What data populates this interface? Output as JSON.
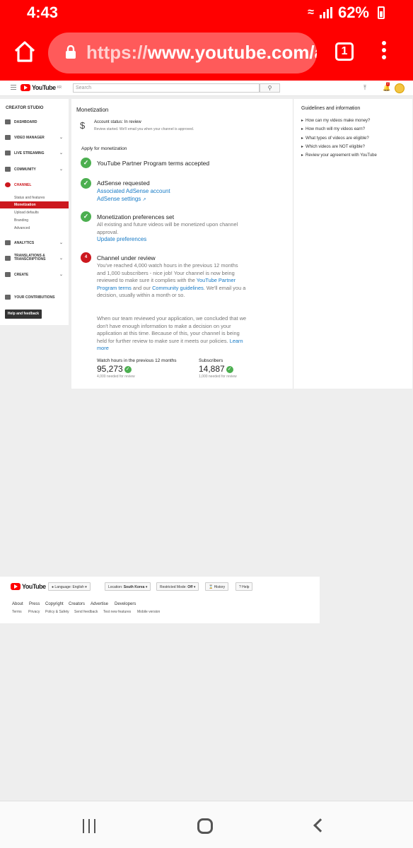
{
  "status_bar": {
    "time": "4:43",
    "battery": "62%"
  },
  "browser": {
    "url_scheme": "https://",
    "url_rest": "www.youtube.com/a",
    "tab_count": "1"
  },
  "header": {
    "logo_text": "YouTube",
    "logo_sup": "KR",
    "search_placeholder": "Search"
  },
  "notifications": {
    "count": "7"
  },
  "sidebar": {
    "title": "CREATOR STUDIO",
    "items": [
      {
        "label": "DASHBOARD"
      },
      {
        "label": "VIDEO MANAGER"
      },
      {
        "label": "LIVE STREAMING"
      },
      {
        "label": "COMMUNITY"
      },
      {
        "label": "CHANNEL"
      },
      {
        "label": "ANALYTICS"
      },
      {
        "label": "TRANSLATIONS & TRANSCRIPTIONS"
      },
      {
        "label": "CREATE"
      },
      {
        "label": "YOUR CONTRIBUTIONS"
      }
    ],
    "channel_sub": [
      "Status and features",
      "Monetization",
      "Upload defaults",
      "Branding",
      "Advanced"
    ],
    "help_button": "Help and feedback"
  },
  "main": {
    "title": "Monetization",
    "account_status": "Account status: In review",
    "account_sub": "Review started. We'll email you when your channel is approved.",
    "apply_title": "Apply for monetization",
    "steps": [
      {
        "title": "YouTube Partner Program terms accepted"
      },
      {
        "title": "AdSense requested",
        "link1": "Associated AdSense account",
        "link2": "AdSense settings"
      },
      {
        "title": "Monetization preferences set",
        "text": "All existing and future videos will be monetized upon channel approval.",
        "link": "Update preferences"
      },
      {
        "number": "4",
        "title": "Channel under review",
        "text_a": "You've reached 4,000 watch hours in the previous 12 months and 1,000 subscribers - nice job! Your channel is now being reviewed to make sure it complies with the ",
        "link_a": "YouTube Partner Program terms",
        "text_b": " and our ",
        "link_b": "Community guidelines",
        "text_c": ". We'll email you a decision, usually within a month or so.",
        "text_d": "When our team reviewed your application, we concluded that we don't have enough information to make a decision on your application at this time. Because of this, your channel is being held for further review to make sure it meets our policies. ",
        "link_d": "Learn more"
      }
    ],
    "stats": [
      {
        "label": "Watch hours in the previous 12 months",
        "value": "95,273",
        "sub": "4,000 needed for review"
      },
      {
        "label": "Subscribers",
        "value": "14,887",
        "sub": "1,000 needed for review"
      }
    ]
  },
  "guidelines": {
    "title": "Guidelines and information",
    "links": [
      "How can my videos make money?",
      "How much will my videos earn?",
      "What types of videos are eligible?",
      "Which videos are NOT eligible?",
      "Review your agreement with YouTube"
    ]
  },
  "footer": {
    "language": "Language: English",
    "location_label": "Location:",
    "location_value": "South Korea",
    "restricted_label": "Restricted Mode:",
    "restricted_value": "Off",
    "history": "History",
    "help": "Help",
    "links": [
      "About",
      "Press",
      "Copyright",
      "Creators",
      "Advertise",
      "Developers"
    ],
    "links2": [
      "Terms",
      "Privacy",
      "Policy & Safety",
      "Send feedback",
      "Test new features",
      "Mobile version"
    ]
  },
  "colors": {
    "brand_red": "#ff0000",
    "link_blue": "#167ac6",
    "success_green": "#4caf50",
    "active_red": "#cc181e"
  }
}
